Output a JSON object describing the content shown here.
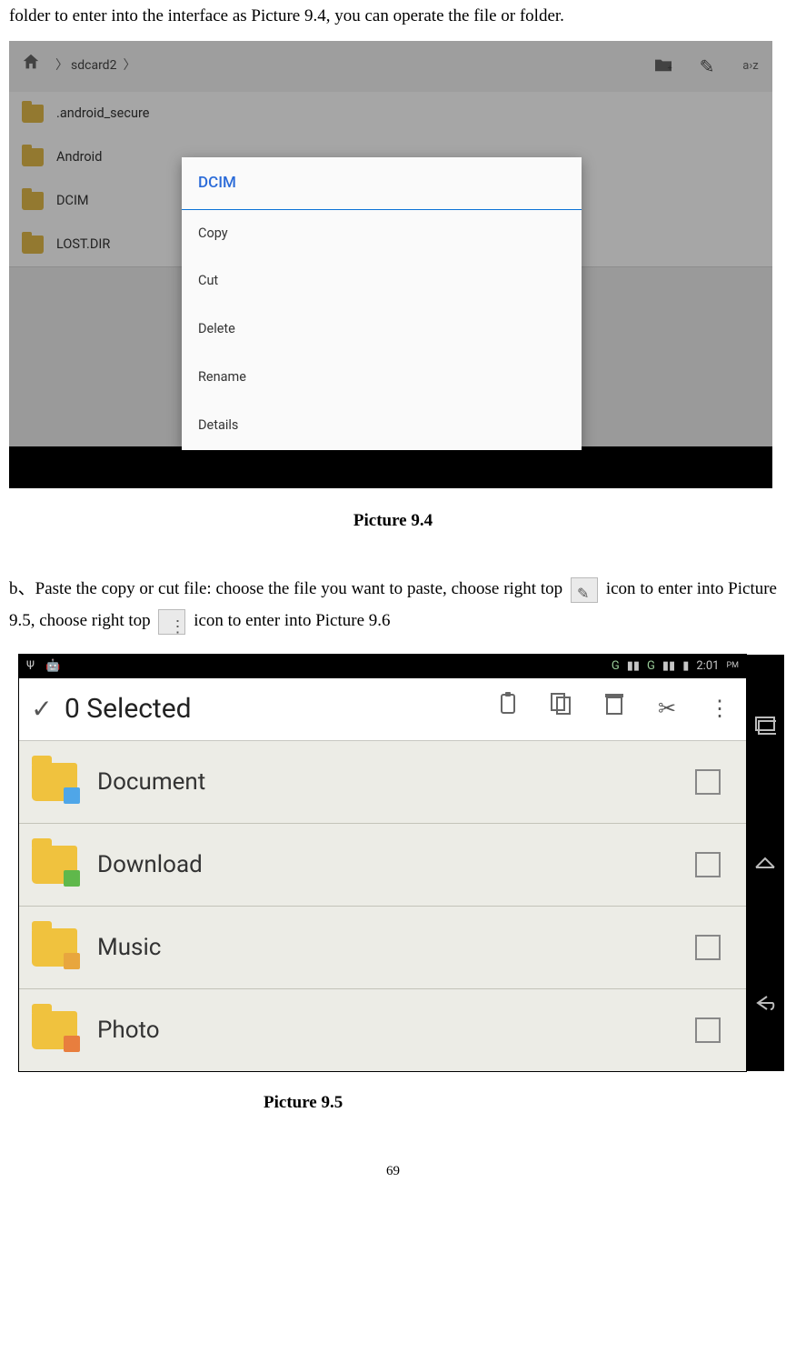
{
  "intro_text": "folder to enter into the interface as Picture 9.4, you can operate the file or folder.",
  "fig94": {
    "breadcrumb": "sdcard2",
    "rows": [
      ".android_secure",
      "Android",
      "DCIM",
      "LOST.DIR"
    ],
    "context_title": "DCIM",
    "context_items": [
      "Copy",
      "Cut",
      "Delete",
      "Rename",
      "Details"
    ],
    "caption": "Picture 9.4"
  },
  "para_b": {
    "seg1": "b、Paste the copy or cut file: choose the file you want to paste, choose right top ",
    "seg2": " icon to enter into Picture 9.5, choose right top ",
    "seg3": " icon to enter into Picture 9.6"
  },
  "fig95": {
    "status_time": "2:01",
    "status_ampm": "PM",
    "selected_label": "0 Selected",
    "folders": [
      "Document",
      "Download",
      "Music",
      "Photo"
    ],
    "caption": "Picture 9.5"
  },
  "pagenum": "69"
}
